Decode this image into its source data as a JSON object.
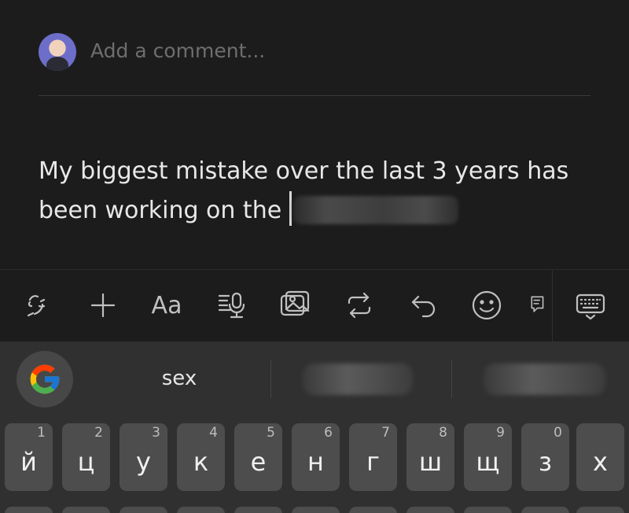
{
  "comment": {
    "placeholder": "Add a comment..."
  },
  "post": {
    "text": "My biggest mistake over the last 3 years has been working on the "
  },
  "toolbar": {
    "icons": [
      "voice-persona-icon",
      "plus-icon",
      "text-format-icon",
      "audio-caption-icon",
      "image-icon",
      "repost-icon",
      "undo-icon",
      "emoji-icon",
      "comment-icon",
      "keyboard-icon"
    ],
    "format_label": "Aa"
  },
  "suggestions": {
    "first": "sex"
  },
  "keys": [
    {
      "hint": "1",
      "ch": "й"
    },
    {
      "hint": "2",
      "ch": "ц"
    },
    {
      "hint": "3",
      "ch": "у"
    },
    {
      "hint": "4",
      "ch": "к"
    },
    {
      "hint": "5",
      "ch": "е"
    },
    {
      "hint": "6",
      "ch": "н"
    },
    {
      "hint": "7",
      "ch": "г"
    },
    {
      "hint": "8",
      "ch": "ш"
    },
    {
      "hint": "9",
      "ch": "щ"
    },
    {
      "hint": "0",
      "ch": "з"
    },
    {
      "hint": "",
      "ch": "х"
    }
  ],
  "colors": {
    "background": "#1c1c1c",
    "keyboard": "#303030",
    "key": "#4d4d4d"
  }
}
